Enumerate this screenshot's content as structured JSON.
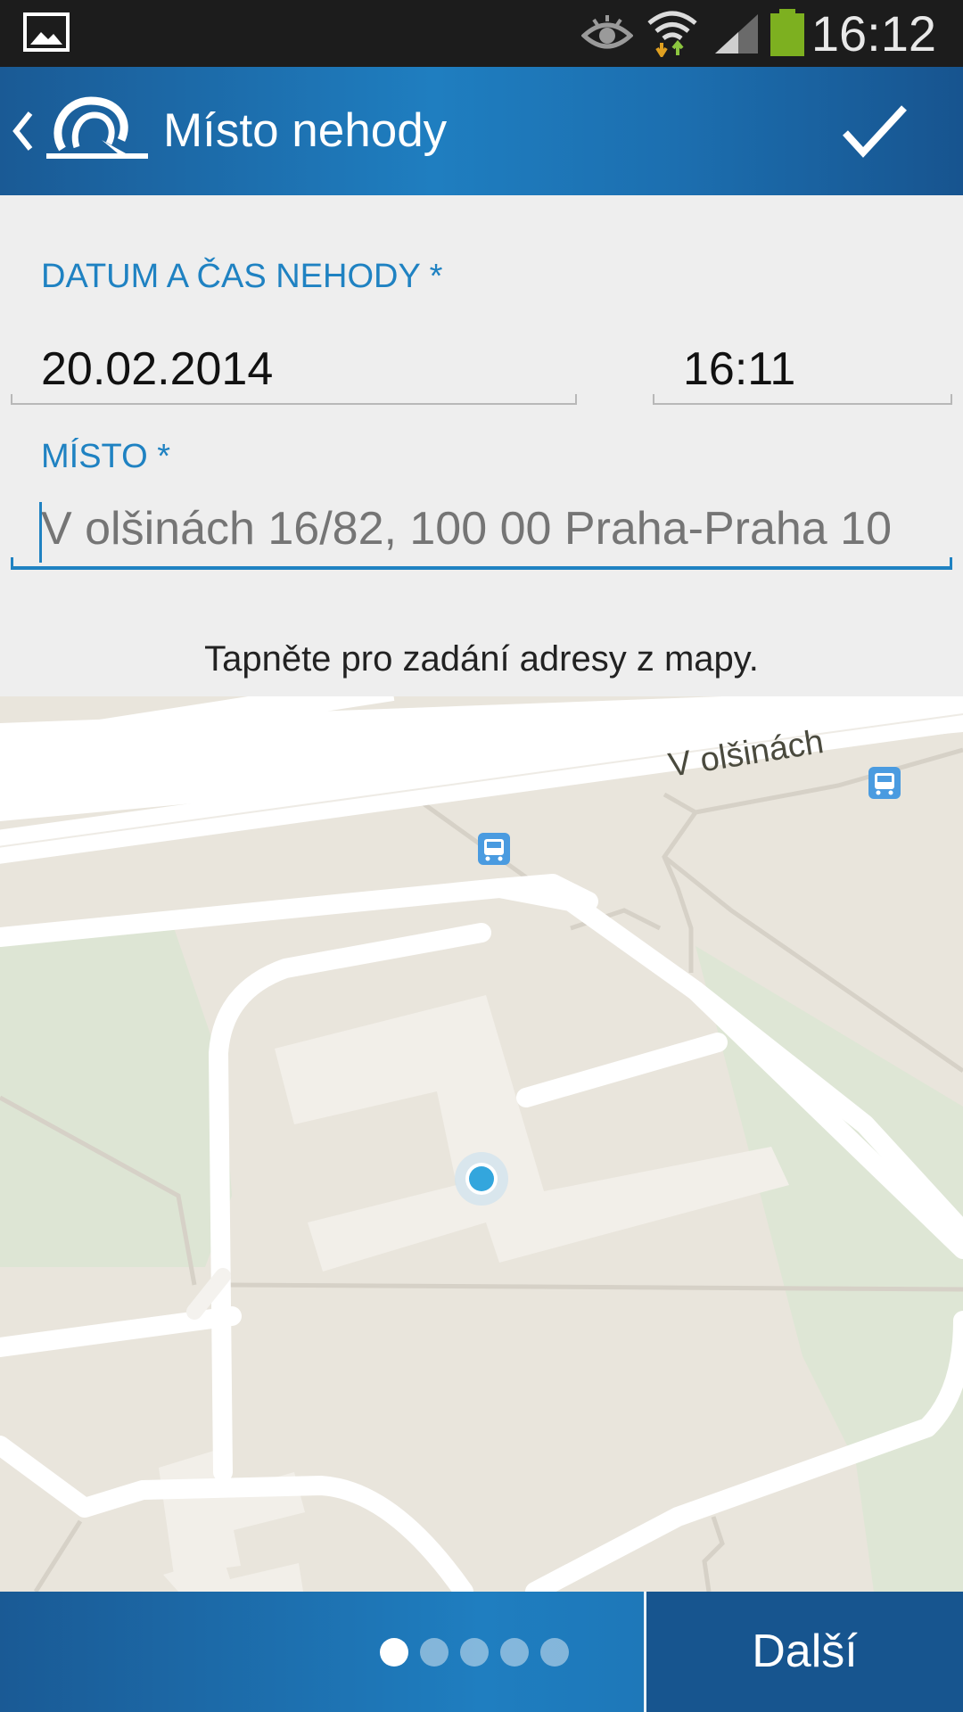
{
  "status_bar": {
    "time": "16:12",
    "icons": [
      "gallery-icon",
      "eye-icon",
      "wifi-icon",
      "signal-icon",
      "battery-icon"
    ],
    "battery_color": "#7db020"
  },
  "action_bar": {
    "title": "Místo nehody",
    "back_icon": "chevron-left-icon",
    "logo_icon": "app-logo-icon",
    "confirm_icon": "checkmark-icon",
    "color": "#1f7ec0"
  },
  "form": {
    "datetime_label": "DATUM A ČAS NEHODY *",
    "date_value": "20.02.2014",
    "time_value": "16:11",
    "place_label": "MÍSTO *",
    "place_placeholder": "V olšinách 16/82, 100 00 Praha-Praha 10",
    "accent_color": "#1f82c2"
  },
  "hint": "Tapněte pro zadání adresy z mapy.",
  "map": {
    "street_label": "V olšinách",
    "markers": [
      "bus-stop-icon",
      "bus-stop-icon",
      "location-dot-icon"
    ]
  },
  "bottom_bar": {
    "pages_total": 5,
    "current_page": 1,
    "next_label": "Další"
  }
}
